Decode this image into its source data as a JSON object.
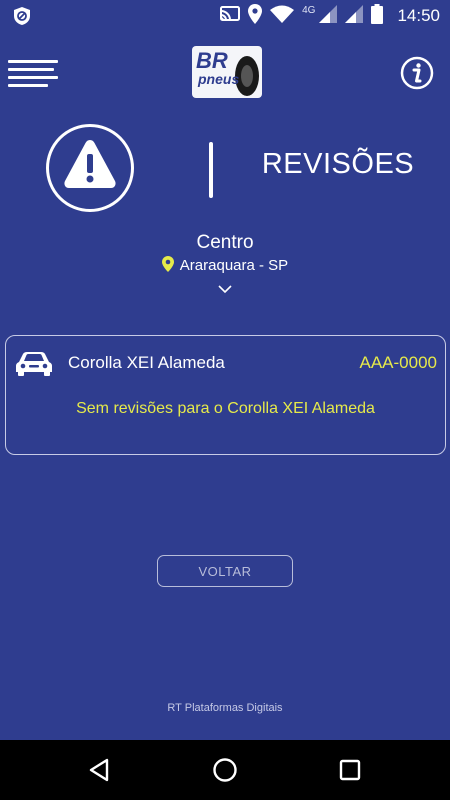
{
  "status_bar": {
    "time": "14:50",
    "network_label": "4G",
    "icons": [
      "vpn-icon",
      "cast-icon",
      "location-icon",
      "wifi-icon",
      "signal-icon",
      "signal-icon-2",
      "battery-icon"
    ]
  },
  "header": {
    "logo_text_top": "BR",
    "logo_text_bottom": "pneus",
    "icons": [
      "menu-icon",
      "info-icon"
    ]
  },
  "title_section": {
    "icon": "warning-icon",
    "title": "REVISÕES"
  },
  "location": {
    "store_name": "Centro",
    "city": "Araraquara - SP",
    "icons": [
      "map-pin-icon",
      "chevron-down-icon"
    ]
  },
  "vehicle": {
    "icon": "car-icon",
    "name": "Corolla XEI Alameda",
    "plate": "AAA-0000",
    "empty_message": "Sem revisões para o Corolla XEI Alameda"
  },
  "actions": {
    "back_label": "VOLTAR"
  },
  "footer": {
    "text": "RT Plataformas Digitais"
  },
  "nav_bar": {
    "icons": [
      "back-triangle-icon",
      "home-circle-icon",
      "recents-square-icon"
    ]
  },
  "colors": {
    "background": "#2f3d8f",
    "accent_yellow": "#e6ea4a",
    "text": "#ffffff"
  }
}
